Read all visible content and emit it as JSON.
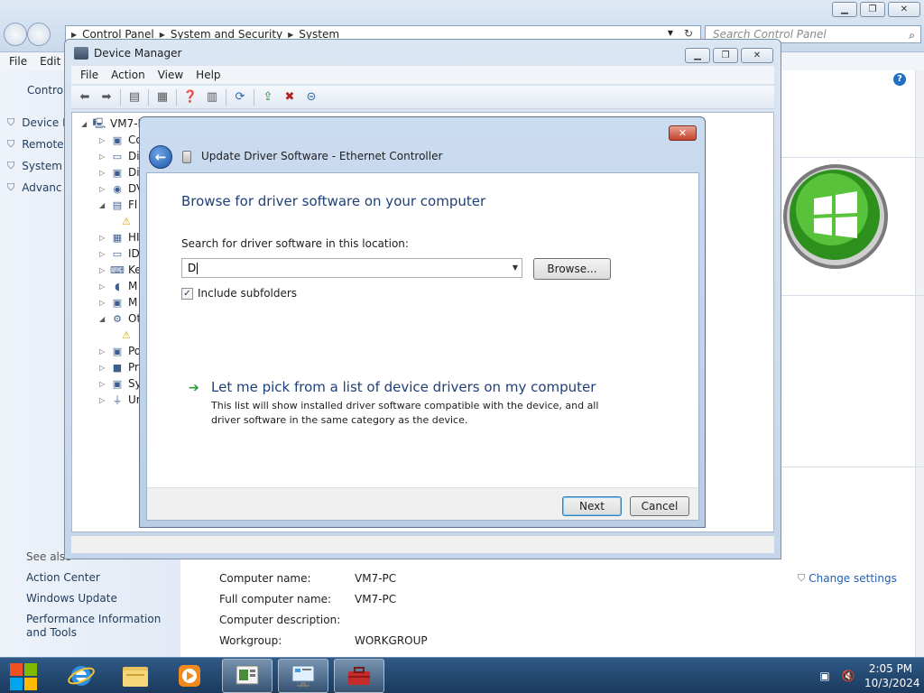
{
  "control_panel": {
    "breadcrumb": [
      "Control Panel",
      "System and Security",
      "System"
    ],
    "search_placeholder": "Search Control Panel",
    "menu": [
      "File",
      "Edit"
    ],
    "left_title": "Control",
    "left_items": [
      "Device M",
      "Remote",
      "System",
      "Advanc"
    ],
    "see_also": "See also",
    "see_also_links": [
      "Action Center",
      "Windows Update",
      "Performance Information and Tools"
    ],
    "system_info": [
      {
        "label": "Computer name:",
        "value": "VM7-PC"
      },
      {
        "label": "Full computer name:",
        "value": "VM7-PC"
      },
      {
        "label": "Computer description:",
        "value": ""
      },
      {
        "label": "Workgroup:",
        "value": "WORKGROUP"
      }
    ],
    "change_settings": "Change settings"
  },
  "device_manager": {
    "title": "Device Manager",
    "menu": [
      "File",
      "Action",
      "View",
      "Help"
    ],
    "tree_root": "VM7-PC",
    "tree_items": [
      "Co",
      "Di",
      "Di",
      "DV",
      "Fl",
      "",
      "HI",
      "ID",
      "Ke",
      "M",
      "M",
      "Ot",
      "",
      "Po",
      "Pr",
      "Sy",
      "Ur"
    ]
  },
  "dialog": {
    "title": "Update Driver Software - Ethernet Controller",
    "heading": "Browse for driver software on your computer",
    "search_label": "Search for driver software in this location:",
    "path_value": "D",
    "browse_label": "Browse...",
    "include_subfolders_label": "Include subfolders",
    "include_subfolders_checked": true,
    "pick_title": "Let me pick from a list of device drivers on my computer",
    "pick_desc": "This list will show installed driver software compatible with the device, and all driver software in the same category as the device.",
    "next_label": "Next",
    "cancel_label": "Cancel"
  },
  "taskbar": {
    "time": "2:05 PM",
    "date": "10/3/2024"
  },
  "colors": {
    "accent": "#1e3f78",
    "link": "#1e5fb8",
    "taskbar": "#1b3a5e"
  }
}
